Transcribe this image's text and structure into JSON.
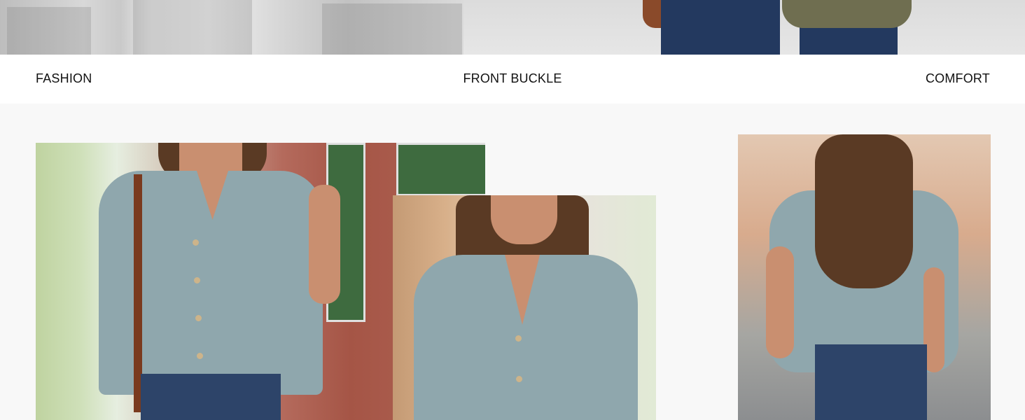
{
  "features": {
    "left": "FASHION",
    "center": "FRONT BUCKLE",
    "right": "COMFORT"
  },
  "images": {
    "top_left": "street-photo",
    "top_right": "model-jeans-photo",
    "front_view": "model-front-photo",
    "closeup": "model-closeup-photo",
    "back_view": "model-back-photo"
  },
  "colors": {
    "shirt": "#8fa7ad",
    "background": "#f8f8f8",
    "label_band": "#ffffff",
    "text": "#111111"
  }
}
